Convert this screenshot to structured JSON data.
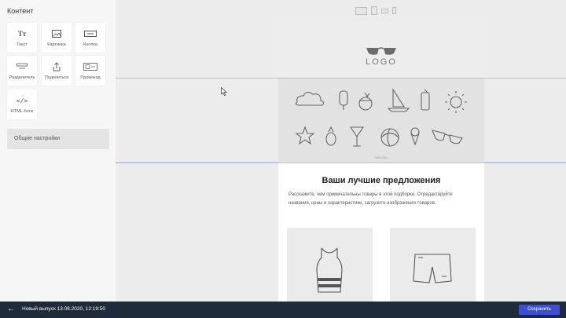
{
  "panel": {
    "title": "Контент",
    "blocks": [
      {
        "label": "Текст",
        "icon": "text-icon",
        "glyph": "Tт"
      },
      {
        "label": "Картинка",
        "icon": "image-icon"
      },
      {
        "label": "Кнопка",
        "icon": "button-icon"
      },
      {
        "label": "Разделитель",
        "icon": "divider-icon"
      },
      {
        "label": "Поделиться",
        "icon": "share-icon"
      },
      {
        "label": "Промокод",
        "icon": "promocode-icon"
      },
      {
        "label": "HTML-блок",
        "icon": "code-icon",
        "glyph": "</>"
      }
    ],
    "settings_label": "Общие настройки"
  },
  "devices": [
    "desktop-icon",
    "tablet-icon",
    "tablet-landscape-icon",
    "mobile-icon"
  ],
  "email": {
    "logo_text": "LOGO",
    "banner_size": "580x250",
    "headline": "Ваши лучшие предложения",
    "body": "Расскажите, чем примечательны товары в этой подборке. Отредактируйте названия, цены и характеристики, загрузите изображения товаров."
  },
  "footer": {
    "back_glyph": "←",
    "issue_label": "Новый выпуск 13.08.2020, 12:19:50",
    "save_label": "Сохранить"
  },
  "colors": {
    "bottom_bar": "#1f2b3a",
    "save_button": "#3f4fd1",
    "selection": "#a9c4ea"
  }
}
